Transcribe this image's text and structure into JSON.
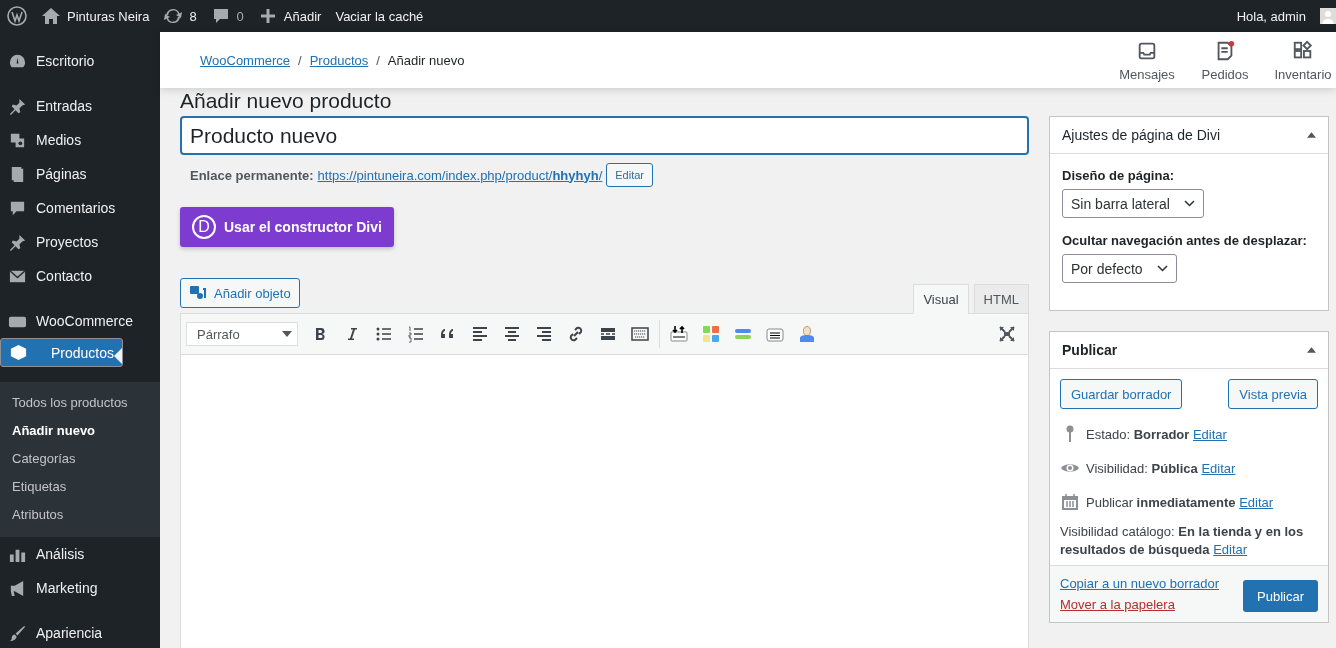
{
  "admin_bar": {
    "site_name": "Pinturas Neira",
    "updates_count": "8",
    "comments_count": "0",
    "new_label": "Añadir",
    "cache_label": "Vaciar la caché",
    "greeting": "Hola, admin"
  },
  "sidebar": {
    "groups": [
      [
        {
          "label": "Escritorio",
          "selected": false
        }
      ],
      [
        {
          "label": "Entradas",
          "selected": false
        },
        {
          "label": "Medios",
          "selected": false
        },
        {
          "label": "Páginas",
          "selected": false
        },
        {
          "label": "Comentarios",
          "selected": false
        },
        {
          "label": "Proyectos",
          "selected": false
        },
        {
          "label": "Contacto",
          "selected": false
        }
      ],
      [
        {
          "label": "WooCommerce",
          "selected": false
        },
        {
          "label": "Productos",
          "selected": true,
          "children": [
            {
              "label": "Todos los productos",
              "selected": false
            },
            {
              "label": "Añadir nuevo",
              "selected": true
            },
            {
              "label": "Categorías",
              "selected": false
            },
            {
              "label": "Etiquetas",
              "selected": false
            },
            {
              "label": "Atributos",
              "selected": false
            }
          ]
        },
        {
          "label": "Análisis",
          "selected": false
        },
        {
          "label": "Marketing",
          "selected": false
        }
      ],
      [
        {
          "label": "Apariencia",
          "selected": false
        }
      ]
    ]
  },
  "header": {
    "separator": "/",
    "breadcrumb": [
      {
        "label": "WooCommerce",
        "link": true
      },
      {
        "label": "Productos",
        "link": true
      },
      {
        "label": "Añadir nuevo",
        "link": false
      }
    ],
    "nav": [
      {
        "label": "Mensajes",
        "alert": false
      },
      {
        "label": "Pedidos",
        "alert": true
      },
      {
        "label": "Inventario",
        "alert": false
      }
    ]
  },
  "page_title": "Añadir nuevo producto",
  "editor": {
    "title_value": "Producto nuevo",
    "permalink_label": "Enlace permanente:",
    "permalink_base": "https://pintuneira.com/index.php/product/",
    "permalink_slug": "hhyhyh",
    "permalink_end": "/",
    "permalink_edit": "Editar",
    "divi_button": "Usar el constructor Divi",
    "divi_letter": "D",
    "add_media": "Añadir objeto",
    "tabs": [
      {
        "label": "Visual",
        "selected": true
      },
      {
        "label": "HTML",
        "selected": false
      }
    ],
    "format": "Párrafo"
  },
  "divi_box": {
    "title": "Ajustes de página de Divi",
    "expanded": true,
    "fields": [
      {
        "label": "Diseño de página:",
        "value": "Sin barra lateral"
      },
      {
        "label": "Ocultar navegación antes de desplazar:",
        "value": "Por defecto"
      }
    ]
  },
  "publish_box": {
    "title": "Publicar",
    "expanded": true,
    "save_draft": "Guardar borrador",
    "preview": "Vista previa",
    "rows": [
      {
        "kind": "status",
        "text": "Estado: **Borrador**",
        "link": "Editar"
      },
      {
        "kind": "visibility",
        "text": "Visibilidad: **Pública**",
        "link": "Editar"
      },
      {
        "kind": "schedule",
        "text": "Publicar **inmediatamente**",
        "link": "Editar"
      },
      {
        "kind": "catalog",
        "text": "Visibilidad catálogo: **En la tienda y en los resultados de búsqueda**",
        "link": "Editar"
      }
    ],
    "copy_link": "Copiar a un nuevo borrador",
    "trash_link": "Mover a la papelera",
    "publish_button": "Publicar"
  }
}
